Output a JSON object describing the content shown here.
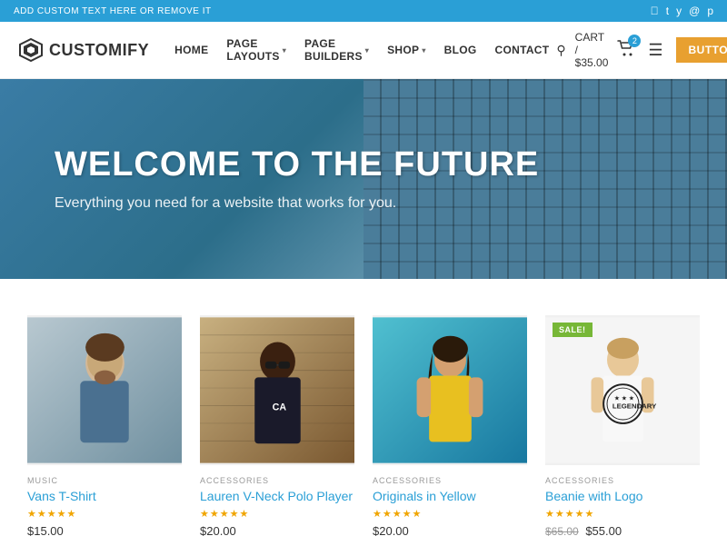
{
  "topbar": {
    "text": "ADD CUSTOM TEXT HERE OR REMOVE IT",
    "social": [
      "f",
      "t",
      "in",
      "ig",
      "p"
    ]
  },
  "header": {
    "logo_text": "CUSTOMIFY",
    "nav_items": [
      {
        "label": "HOME",
        "has_dropdown": false
      },
      {
        "label": "PAGE LAYOUTS",
        "has_dropdown": true
      },
      {
        "label": "PAGE BUILDERS",
        "has_dropdown": true
      },
      {
        "label": "SHOP",
        "has_dropdown": true
      },
      {
        "label": "BLOG",
        "has_dropdown": false
      },
      {
        "label": "CONTACT",
        "has_dropdown": false
      }
    ],
    "cart_text": "CART / $35.00",
    "cart_count": "2",
    "button_label": "BUTTON"
  },
  "hero": {
    "title": "WELCOME TO THE FUTURE",
    "subtitle": "Everything you need for a website that works for you."
  },
  "products": [
    {
      "category": "MUSIC",
      "name": "Vans T-Shirt",
      "stars": 5,
      "price": "$15.00",
      "sale": false,
      "img_style": "1"
    },
    {
      "category": "ACCESSORIES",
      "name": "Lauren V-Neck Polo Player",
      "stars": 5,
      "price": "$20.00",
      "sale": false,
      "img_style": "2"
    },
    {
      "category": "ACCESSORIES",
      "name": "Originals in Yellow",
      "stars": 5,
      "price": "$20.00",
      "sale": false,
      "img_style": "3"
    },
    {
      "category": "ACCESSORIES",
      "name": "Beanie with Logo",
      "stars": 5,
      "price_original": "$65.00",
      "price": "$55.00",
      "sale": true,
      "img_style": "4"
    }
  ]
}
